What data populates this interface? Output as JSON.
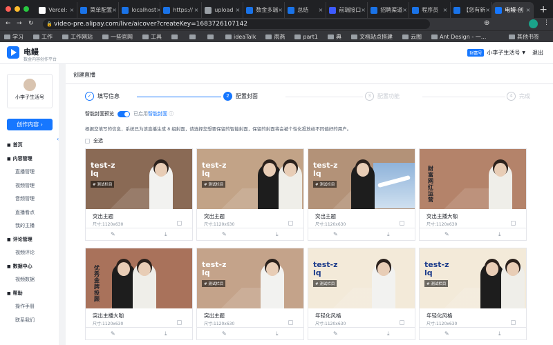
{
  "browser": {
    "tabs": [
      {
        "label": "Vercel:",
        "color": "#ffffff"
      },
      {
        "label": "菜单配置",
        "color": "#1a73e8"
      },
      {
        "label": "localhost",
        "color": "#1a73e8"
      },
      {
        "label": "https://",
        "color": "#1a73e8"
      },
      {
        "label": "upload",
        "color": "#9aa0a6"
      },
      {
        "label": "数金多端",
        "color": "#1a73e8"
      },
      {
        "label": "总结",
        "color": "#1a73e8"
      },
      {
        "label": "前端接口",
        "color": "#3d5afe"
      },
      {
        "label": "招聘渠道",
        "color": "#1a73e8"
      },
      {
        "label": "程序员",
        "color": "#1a73e8"
      },
      {
        "label": "【您有新",
        "color": "#1a73e8"
      },
      {
        "label": "电鳗-创",
        "color": "#1677ff",
        "active": true
      }
    ],
    "url": "video-pre.alipay.com/live/aicover?createKey=1683726107142",
    "bookmarks": [
      "学习",
      "工作",
      "工作网站",
      "一些官网",
      "工具",
      "",
      "",
      "",
      "ideaTalk",
      "雨燕",
      "part1",
      "典",
      "文档站点搭建",
      "云图",
      "Ant Design - 一..."
    ],
    "bookmark_other": "其他书签"
  },
  "header": {
    "brand": "电鳗",
    "brand_sub": "数金内容创作平台",
    "account_badge": "财富号",
    "account_name": "小李子生活号",
    "logout": "退出"
  },
  "sidebar": {
    "profile_name": "小李子生活号",
    "create_btn": "创作内容",
    "nav": [
      {
        "label": "首页",
        "group": true
      },
      {
        "label": "内容管理",
        "group": true
      },
      {
        "label": "直播管理"
      },
      {
        "label": "视频管理"
      },
      {
        "label": "音频管理"
      },
      {
        "label": "直播看点"
      },
      {
        "label": "我的主播"
      },
      {
        "label": "评论管理",
        "group": true
      },
      {
        "label": "视频评论"
      },
      {
        "label": "数据中心",
        "group": true
      },
      {
        "label": "视频数据"
      },
      {
        "label": "帮助",
        "group": true
      },
      {
        "label": "操作手册"
      },
      {
        "label": "联系我们"
      }
    ]
  },
  "main": {
    "page_title": "创建直播",
    "steps": [
      {
        "num": "✓",
        "label": "填写信息",
        "state": "done"
      },
      {
        "num": "2",
        "label": "配置封面",
        "state": "active"
      },
      {
        "num": "3",
        "label": "配置功能",
        "state": "todo"
      },
      {
        "num": "4",
        "label": "完成",
        "state": "todo"
      }
    ],
    "smart_label": "智能封面预览",
    "smart_hint_pre": "已启用",
    "smart_hint_link": "智能封面",
    "desc": "根据您填写的信息，系统已为该直播生成 8 组封面，请选择您想要保留的智能封面，保留的封面将会被个性化投放给不同偏好的用户。",
    "select_all": "全选",
    "cards": [
      {
        "title": "突出主题",
        "size": "尺寸:1120x630",
        "cover_text": "test-z\nlq",
        "tag": "# 测试栏目",
        "bg": "#8a6a55",
        "text_color": "#ffffff"
      },
      {
        "title": "突出主题",
        "size": "尺寸:1120x630",
        "cover_text": "test-z\nlq",
        "tag": "# 测试栏目",
        "bg": "#c2a387",
        "text_color": "#ffffff"
      },
      {
        "title": "突出主题",
        "size": "尺寸:1120x630",
        "cover_text": "test-z\nlq",
        "tag": "# 测试栏目",
        "bg": "#b39278",
        "text_color": "#ffffff"
      },
      {
        "title": "突出主播大咖",
        "size": "尺寸:1120x630",
        "cover_text": "财富网红运营",
        "tag": "",
        "bg": "#b4836a",
        "text_color": "#1d2129"
      },
      {
        "title": "突出主播大咖",
        "size": "尺寸:1120x630",
        "cover_text": "优秀金牌投顾",
        "tag": "",
        "bg": "#a9725b",
        "text_color": "#1d2129"
      },
      {
        "title": "突出主题",
        "size": "尺寸:1120x630",
        "cover_text": "test-z\nlq",
        "tag": "# 测试栏目",
        "bg": "#c4a38a",
        "text_color": "#ffffff"
      },
      {
        "title": "年轻化风格",
        "size": "尺寸:1120x630",
        "cover_text": "test-z\nlq",
        "tag": "# 测试栏目",
        "bg": "#f3ead9",
        "text_color": "#1a3a8a"
      },
      {
        "title": "年轻化风格",
        "size": "尺寸:1120x630",
        "cover_text": "test-z\nlq",
        "tag": "# 测试栏目",
        "bg": "#f3ead9",
        "text_color": "#1a3a8a"
      }
    ]
  }
}
